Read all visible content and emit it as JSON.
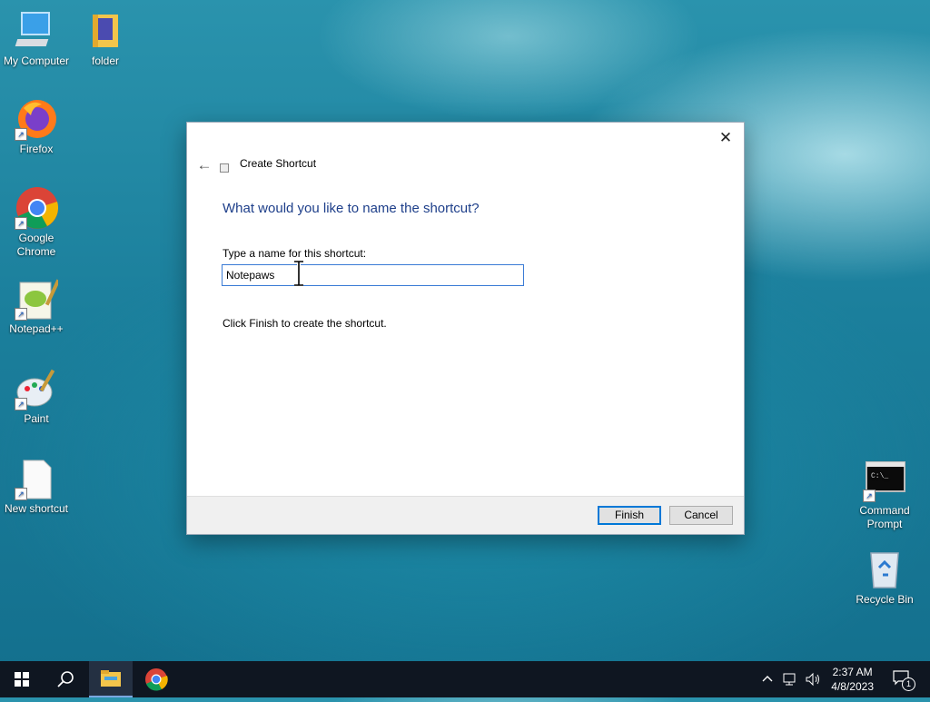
{
  "desktop": {
    "icons": [
      {
        "label": "My Computer",
        "icon": "computer-icon"
      },
      {
        "label": "folder",
        "icon": "folder-icon"
      },
      {
        "label": "Firefox",
        "icon": "firefox-icon"
      },
      {
        "label": "Google Chrome",
        "icon": "chrome-icon"
      },
      {
        "label": "Notepad++",
        "icon": "notepadpp-icon"
      },
      {
        "label": "Paint",
        "icon": "paint-icon"
      },
      {
        "label": "New shortcut",
        "icon": "blank-file-icon"
      },
      {
        "label": "Command Prompt",
        "icon": "cmd-icon"
      },
      {
        "label": "Recycle Bin",
        "icon": "recycle-bin-icon"
      }
    ]
  },
  "dialog": {
    "wizard_title": "Create Shortcut",
    "heading": "What would you like to name the shortcut?",
    "field_label": "Type a name for this shortcut:",
    "name_value": "Notepaws",
    "hint": "Click Finish to create the shortcut.",
    "finish_label": "Finish",
    "cancel_label": "Cancel",
    "close_glyph": "✕",
    "back_glyph": "←"
  },
  "taskbar": {
    "time": "2:37 AM",
    "date": "4/8/2023",
    "notification_count": "1"
  },
  "colors": {
    "accent": "#0078d7",
    "heading": "#1e3f8a"
  }
}
